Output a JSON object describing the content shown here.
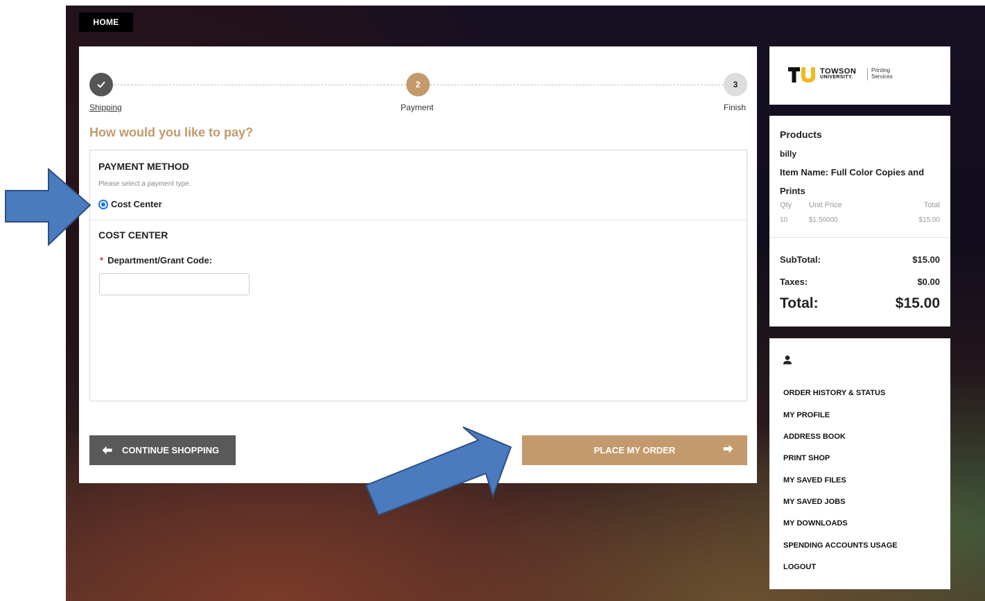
{
  "nav": {
    "home_label": "HOME"
  },
  "stepper": {
    "steps": [
      {
        "number": "",
        "label": "Shipping"
      },
      {
        "number": "2",
        "label": "Payment"
      },
      {
        "number": "3",
        "label": "Finish"
      }
    ]
  },
  "payment": {
    "heading": "How would you like to pay?",
    "method_title": "PAYMENT METHOD",
    "method_hint": "Please select a payment type.",
    "option_label": "Cost Center",
    "cost_center_title": "COST CENTER",
    "required_mark": "*",
    "field_label": "Department/Grant Code:",
    "field_value": ""
  },
  "buttons": {
    "continue_label": "CONTINUE SHOPPING",
    "place_order_label": "PLACE MY ORDER"
  },
  "brand": {
    "name_line1": "TOWSON",
    "name_line2": "UNIVERSITY.",
    "dept_line1": "Printing",
    "dept_line2": "Services",
    "logo_letters": "TU"
  },
  "products": {
    "title": "Products",
    "customer": "billy",
    "item_name_line1": "Item Name: Full Color Copies and",
    "item_name_line2": "Prints",
    "headers": {
      "qty": "Qty",
      "unit_price": "Unit Price",
      "total": "Total"
    },
    "row": {
      "qty": "10",
      "unit_price": "$1.50000",
      "total": "$15.00"
    },
    "subtotal_label": "SubTotal:",
    "subtotal_value": "$15.00",
    "taxes_label": "Taxes:",
    "taxes_value": "$0.00",
    "total_label": "Total:",
    "total_value": "$15.00"
  },
  "account_menu": {
    "items": [
      "ORDER HISTORY & STATUS",
      "MY PROFILE",
      "ADDRESS BOOK",
      "PRINT SHOP",
      "MY SAVED FILES",
      "MY SAVED JOBS",
      "MY DOWNLOADS",
      "SPENDING ACCOUNTS USAGE",
      "LOGOUT"
    ]
  },
  "colors": {
    "accent_gold": "#c49a6c",
    "annotation_arrow": "#4a7bbf",
    "radio_blue": "#1a73e8"
  }
}
